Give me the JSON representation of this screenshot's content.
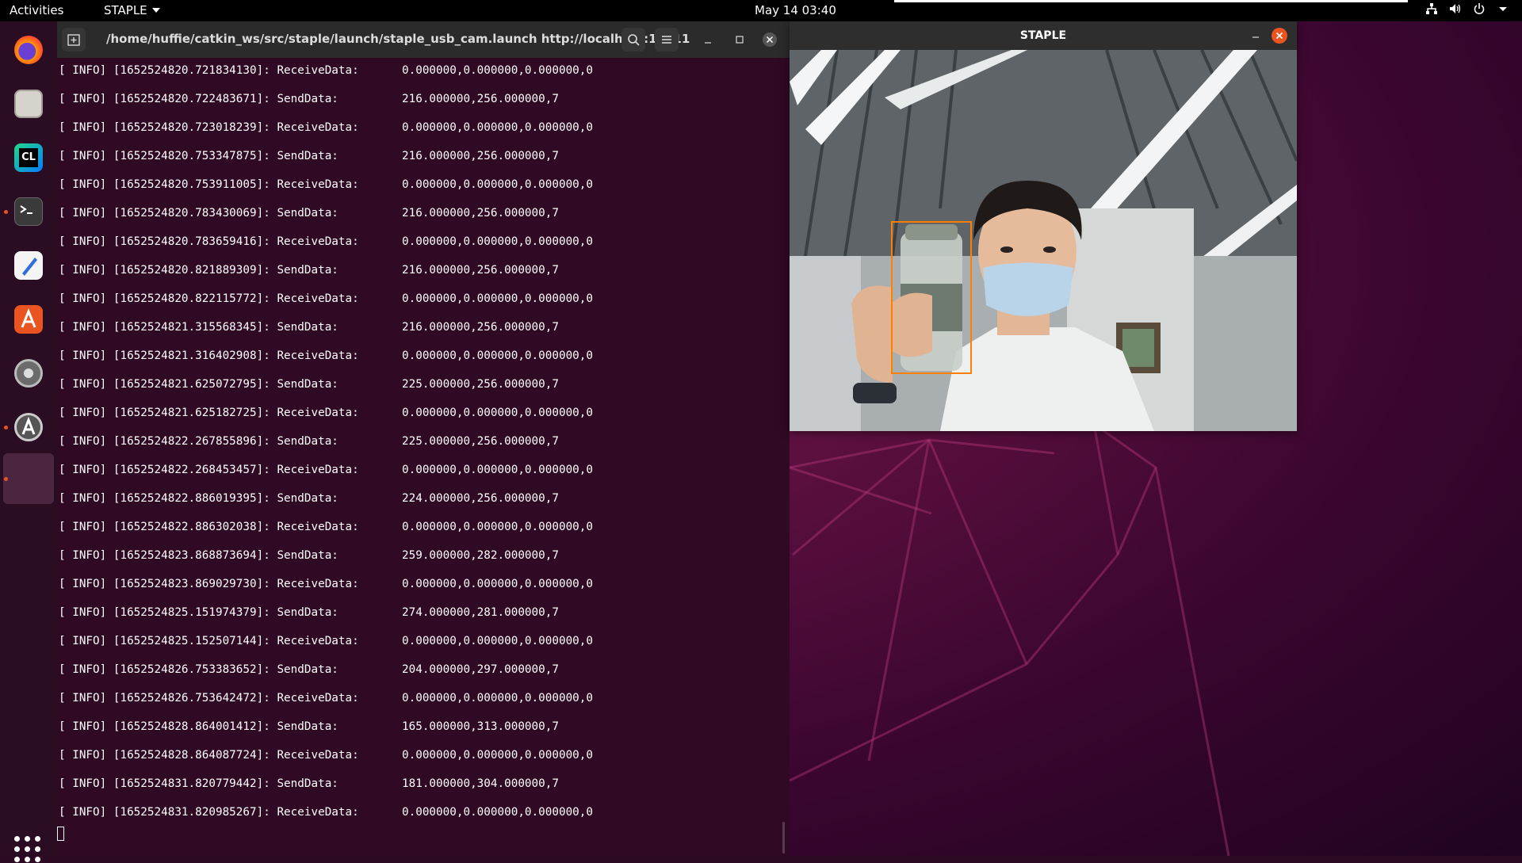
{
  "topbar": {
    "activities": "Activities",
    "app_name": "STAPLE",
    "clock": "May 14  03:40"
  },
  "dock": {
    "items": [
      {
        "name": "firefox-icon"
      },
      {
        "name": "files-icon"
      },
      {
        "name": "clion-icon",
        "label": "CL"
      },
      {
        "name": "terminal-icon"
      },
      {
        "name": "text-editor-icon"
      },
      {
        "name": "software-center-icon"
      },
      {
        "name": "settings-icon"
      },
      {
        "name": "software-updater-icon"
      },
      {
        "name": "staple-app-icon"
      }
    ]
  },
  "terminal": {
    "title": "/home/huffie/catkin_ws/src/staple/launch/staple_usb_cam.launch http://localhost:11311",
    "lines": [
      {
        "msg": "[ INFO] [1652524820.721834130]: ReceiveData:",
        "val": "0.000000,0.000000,0.000000,0"
      },
      {
        "msg": "[ INFO] [1652524820.722483671]: SendData:",
        "val": "216.000000,256.000000,7"
      },
      {
        "msg": "[ INFO] [1652524820.723018239]: ReceiveData:",
        "val": "0.000000,0.000000,0.000000,0"
      },
      {
        "msg": "[ INFO] [1652524820.753347875]: SendData:",
        "val": "216.000000,256.000000,7"
      },
      {
        "msg": "[ INFO] [1652524820.753911005]: ReceiveData:",
        "val": "0.000000,0.000000,0.000000,0"
      },
      {
        "msg": "[ INFO] [1652524820.783430069]: SendData:",
        "val": "216.000000,256.000000,7"
      },
      {
        "msg": "[ INFO] [1652524820.783659416]: ReceiveData:",
        "val": "0.000000,0.000000,0.000000,0"
      },
      {
        "msg": "[ INFO] [1652524820.821889309]: SendData:",
        "val": "216.000000,256.000000,7"
      },
      {
        "msg": "[ INFO] [1652524820.822115772]: ReceiveData:",
        "val": "0.000000,0.000000,0.000000,0"
      },
      {
        "msg": "[ INFO] [1652524821.315568345]: SendData:",
        "val": "216.000000,256.000000,7"
      },
      {
        "msg": "[ INFO] [1652524821.316402908]: ReceiveData:",
        "val": "0.000000,0.000000,0.000000,0"
      },
      {
        "msg": "[ INFO] [1652524821.625072795]: SendData:",
        "val": "225.000000,256.000000,7"
      },
      {
        "msg": "[ INFO] [1652524821.625182725]: ReceiveData:",
        "val": "0.000000,0.000000,0.000000,0"
      },
      {
        "msg": "[ INFO] [1652524822.267855896]: SendData:",
        "val": "225.000000,256.000000,7"
      },
      {
        "msg": "[ INFO] [1652524822.268453457]: ReceiveData:",
        "val": "0.000000,0.000000,0.000000,0"
      },
      {
        "msg": "[ INFO] [1652524822.886019395]: SendData:",
        "val": "224.000000,256.000000,7"
      },
      {
        "msg": "[ INFO] [1652524822.886302038]: ReceiveData:",
        "val": "0.000000,0.000000,0.000000,0"
      },
      {
        "msg": "[ INFO] [1652524823.868873694]: SendData:",
        "val": "259.000000,282.000000,7"
      },
      {
        "msg": "[ INFO] [1652524823.869029730]: ReceiveData:",
        "val": "0.000000,0.000000,0.000000,0"
      },
      {
        "msg": "[ INFO] [1652524825.151974379]: SendData:",
        "val": "274.000000,281.000000,7"
      },
      {
        "msg": "[ INFO] [1652524825.152507144]: ReceiveData:",
        "val": "0.000000,0.000000,0.000000,0"
      },
      {
        "msg": "[ INFO] [1652524826.753383652]: SendData:",
        "val": "204.000000,297.000000,7"
      },
      {
        "msg": "[ INFO] [1652524826.753642472]: ReceiveData:",
        "val": "0.000000,0.000000,0.000000,0"
      },
      {
        "msg": "[ INFO] [1652524828.864001412]: SendData:",
        "val": "165.000000,313.000000,7"
      },
      {
        "msg": "[ INFO] [1652524828.864087724]: ReceiveData:",
        "val": "0.000000,0.000000,0.000000,0"
      },
      {
        "msg": "[ INFO] [1652524831.820779442]: SendData:",
        "val": "181.000000,304.000000,7"
      },
      {
        "msg": "[ INFO] [1652524831.820985267]: ReceiveData:",
        "val": "0.000000,0.000000,0.000000,0"
      }
    ]
  },
  "staple_window": {
    "title": "STAPLE",
    "tracking_box_color": "#ff8000"
  },
  "colors": {
    "terminal_bg": "#300a24",
    "accent": "#e95420"
  }
}
